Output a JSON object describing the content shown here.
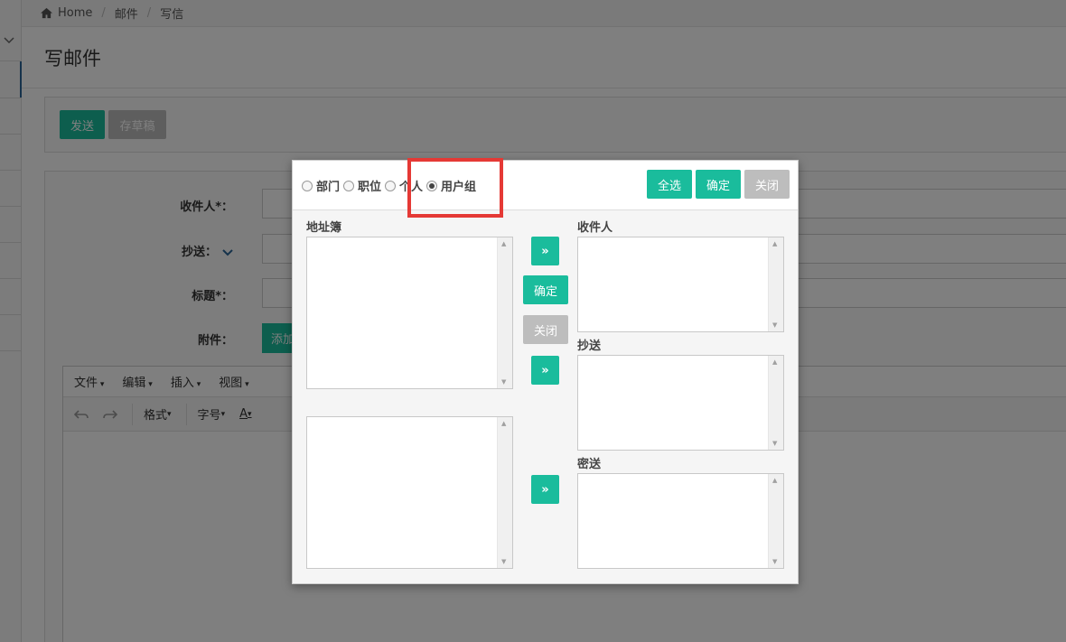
{
  "breadcrumb": {
    "home": "Home",
    "mail": "邮件",
    "compose": "写信"
  },
  "page": {
    "title": "写邮件"
  },
  "actions": {
    "send": "发送",
    "save_draft": "存草稿"
  },
  "form": {
    "recipient_label": "收件人*：",
    "cc_label": "抄送：",
    "subject_label": "标题*：",
    "attachment_label": "附件：",
    "add_button": "添加"
  },
  "editor": {
    "menus": [
      "文件",
      "编辑",
      "插入",
      "视图"
    ],
    "toolbar": {
      "format": "格式",
      "font_size": "字号",
      "font_color": "A"
    }
  },
  "dialog": {
    "radio_options": [
      {
        "label": "部门",
        "checked": false
      },
      {
        "label": "职位",
        "checked": false
      },
      {
        "label": "个人",
        "checked": false
      },
      {
        "label": "用户组",
        "checked": true
      }
    ],
    "select_all": "全选",
    "confirm": "确定",
    "close": "关闭",
    "address_book_label": "地址簿",
    "recipient_label": "收件人",
    "cc_label": "抄送",
    "bcc_label": "密送",
    "arrow_symbol": "»",
    "middle_confirm": "确定",
    "middle_close": "关闭"
  },
  "colors": {
    "primary": "#1abc9c",
    "disabled": "#bdbdbd",
    "highlight": "#e53935"
  }
}
